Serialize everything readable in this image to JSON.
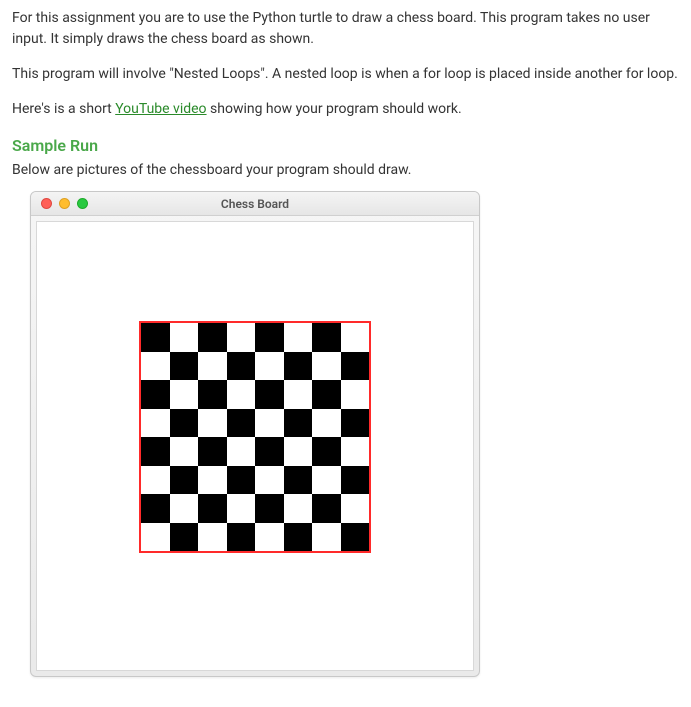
{
  "paragraphs": {
    "p1": "For this assignment you are to use the Python turtle to draw a chess board. This program takes no user input. It simply draws the chess board as shown.",
    "p2a": "This program will involve \"Nested Loops\". A nested loop is when a for loop is placed inside another for loop.",
    "p3_prefix": "Here's is a short ",
    "p3_link": "YouTube video",
    "p3_suffix": " showing how your program should work."
  },
  "headings": {
    "sample_run": "Sample Run"
  },
  "caption": "Below are pictures of the chessboard your program should draw.",
  "window": {
    "title": "Chess Board"
  },
  "board": {
    "rows": 8,
    "cols": 8,
    "border_color": "#ff2a2a",
    "pattern": "alternating",
    "top_left": "black"
  }
}
